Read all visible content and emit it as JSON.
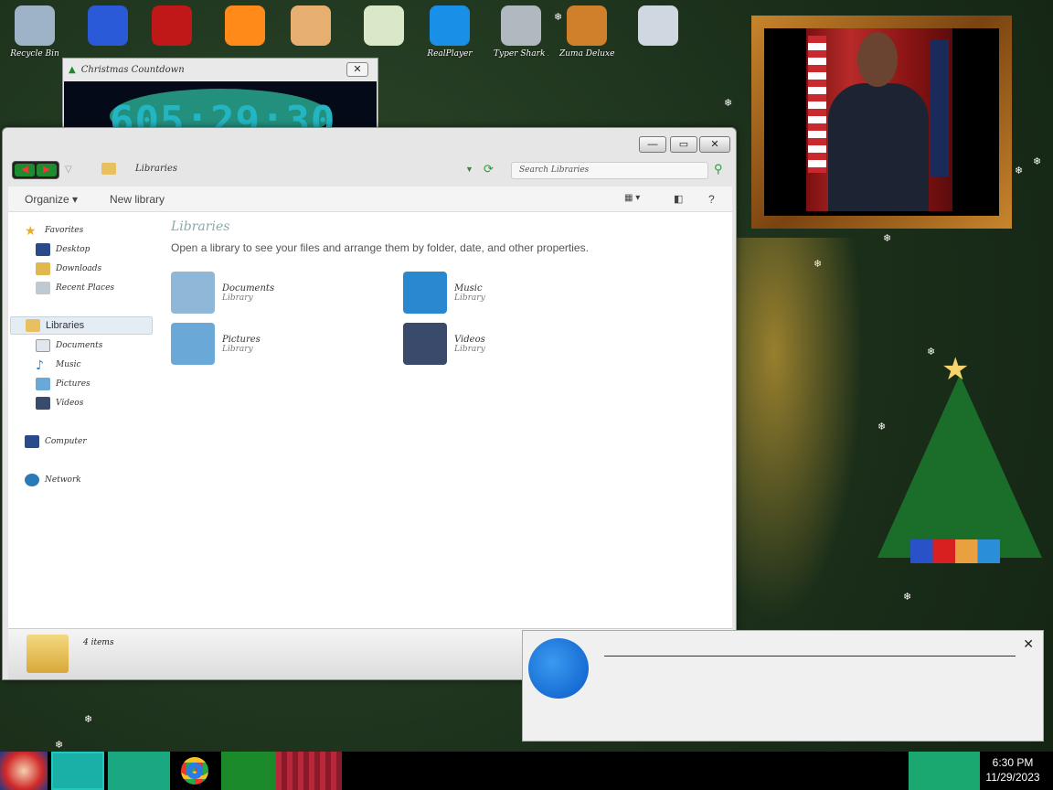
{
  "desktop": {
    "icons": [
      {
        "label": "Recycle Bin",
        "color": "#9fb3c8"
      },
      {
        "label": "",
        "color": "#2a5ad8"
      },
      {
        "label": "",
        "color": "#c01818"
      },
      {
        "label": "",
        "color": "#ff8a1a"
      },
      {
        "label": "",
        "color": "#e8b070"
      },
      {
        "label": "",
        "color": "#d9e8c8"
      },
      {
        "label": "RealPlayer",
        "color": "#1a8fe8"
      },
      {
        "label": "Typer Shark Deluxe",
        "color": "#b0b8c0"
      },
      {
        "label": "Zuma Deluxe",
        "color": "#d0802a"
      },
      {
        "label": "",
        "color": "#cfd8e0"
      }
    ],
    "bottom_label": ""
  },
  "countdown": {
    "title": "Christmas Countdown",
    "close": "✕",
    "time": "605:29:30"
  },
  "explorer": {
    "buttons": {
      "minimize": "—",
      "maximize": "▭",
      "close": "✕"
    },
    "address": "Libraries",
    "search_placeholder": "Search Libraries",
    "toolbar": {
      "organize": "Organize ▾",
      "new_library": "New library",
      "help": "?"
    },
    "sidebar": {
      "favorites": {
        "title": "Favorites",
        "items": [
          "Desktop",
          "Downloads",
          "Recent Places"
        ]
      },
      "libraries": {
        "title": "Libraries",
        "items": [
          "Documents",
          "Music",
          "Pictures",
          "Videos"
        ]
      },
      "computer": "Computer",
      "network": "Network"
    },
    "main": {
      "heading": "Libraries",
      "description": "Open a library to see your files and arrange them by folder, date, and other properties.",
      "items": [
        {
          "name": "Documents",
          "type": "Library",
          "color": "#8fb8d8"
        },
        {
          "name": "Music",
          "type": "Library",
          "color": "#2a88d0"
        },
        {
          "name": "Pictures",
          "type": "Library",
          "color": "#6aa8d8"
        },
        {
          "name": "Videos",
          "type": "Library",
          "color": "#3a4a6a"
        }
      ]
    },
    "details": {
      "count": "4 items"
    }
  },
  "notification": {
    "sender": "",
    "subject": "",
    "preview": "",
    "close": "✕"
  },
  "taskbar": {
    "time": "6:30 PM",
    "date": "11/29/2023"
  }
}
